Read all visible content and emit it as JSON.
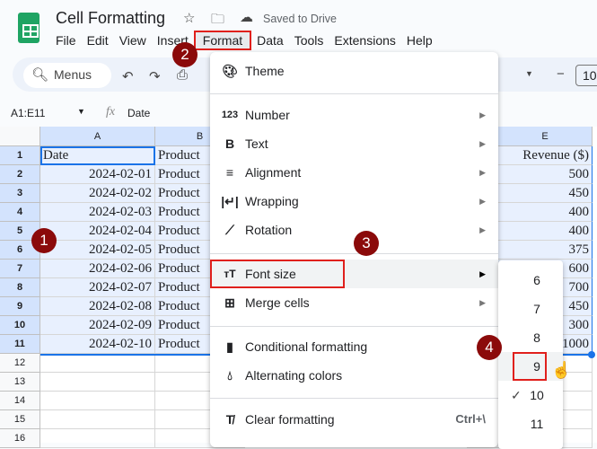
{
  "app": {
    "title": "Cell Formatting",
    "saved": "Saved to Drive"
  },
  "menubar": [
    "File",
    "Edit",
    "View",
    "Insert",
    "Format",
    "Data",
    "Tools",
    "Extensions",
    "Help"
  ],
  "toolbar": {
    "search": "Menus",
    "font_size": "10"
  },
  "formula": {
    "range": "A1:E11",
    "fx": "fx",
    "value": "Date"
  },
  "columns": [
    "A",
    "B",
    "E"
  ],
  "rows": [
    "1",
    "2",
    "3",
    "4",
    "5",
    "6",
    "7",
    "8",
    "9",
    "10",
    "11",
    "12",
    "13",
    "14",
    "15",
    "16"
  ],
  "colA": [
    "Date",
    "2024-02-01",
    "2024-02-02",
    "2024-02-03",
    "2024-02-04",
    "2024-02-05",
    "2024-02-06",
    "2024-02-07",
    "2024-02-08",
    "2024-02-09",
    "2024-02-10"
  ],
  "colB": [
    "Product",
    "Product",
    "Product",
    "Product",
    "Product",
    "Product",
    "Product",
    "Product",
    "Product",
    "Product",
    "Product"
  ],
  "colE": [
    "Revenue ($)",
    "500",
    "450",
    "400",
    "400",
    "375",
    "600",
    "700",
    "450",
    "300",
    "1000"
  ],
  "format_menu": {
    "theme": "Theme",
    "number": "Number",
    "text": "Text",
    "alignment": "Alignment",
    "wrapping": "Wrapping",
    "rotation": "Rotation",
    "font_size": "Font size",
    "merge": "Merge cells",
    "conditional": "Conditional formatting",
    "alternating": "Alternating colors",
    "clear": "Clear formatting",
    "clear_shortcut": "Ctrl+\\"
  },
  "font_sizes": [
    "6",
    "7",
    "8",
    "9",
    "10",
    "11"
  ],
  "selected_font_size": "10",
  "badges": [
    "1",
    "2",
    "3",
    "4"
  ]
}
